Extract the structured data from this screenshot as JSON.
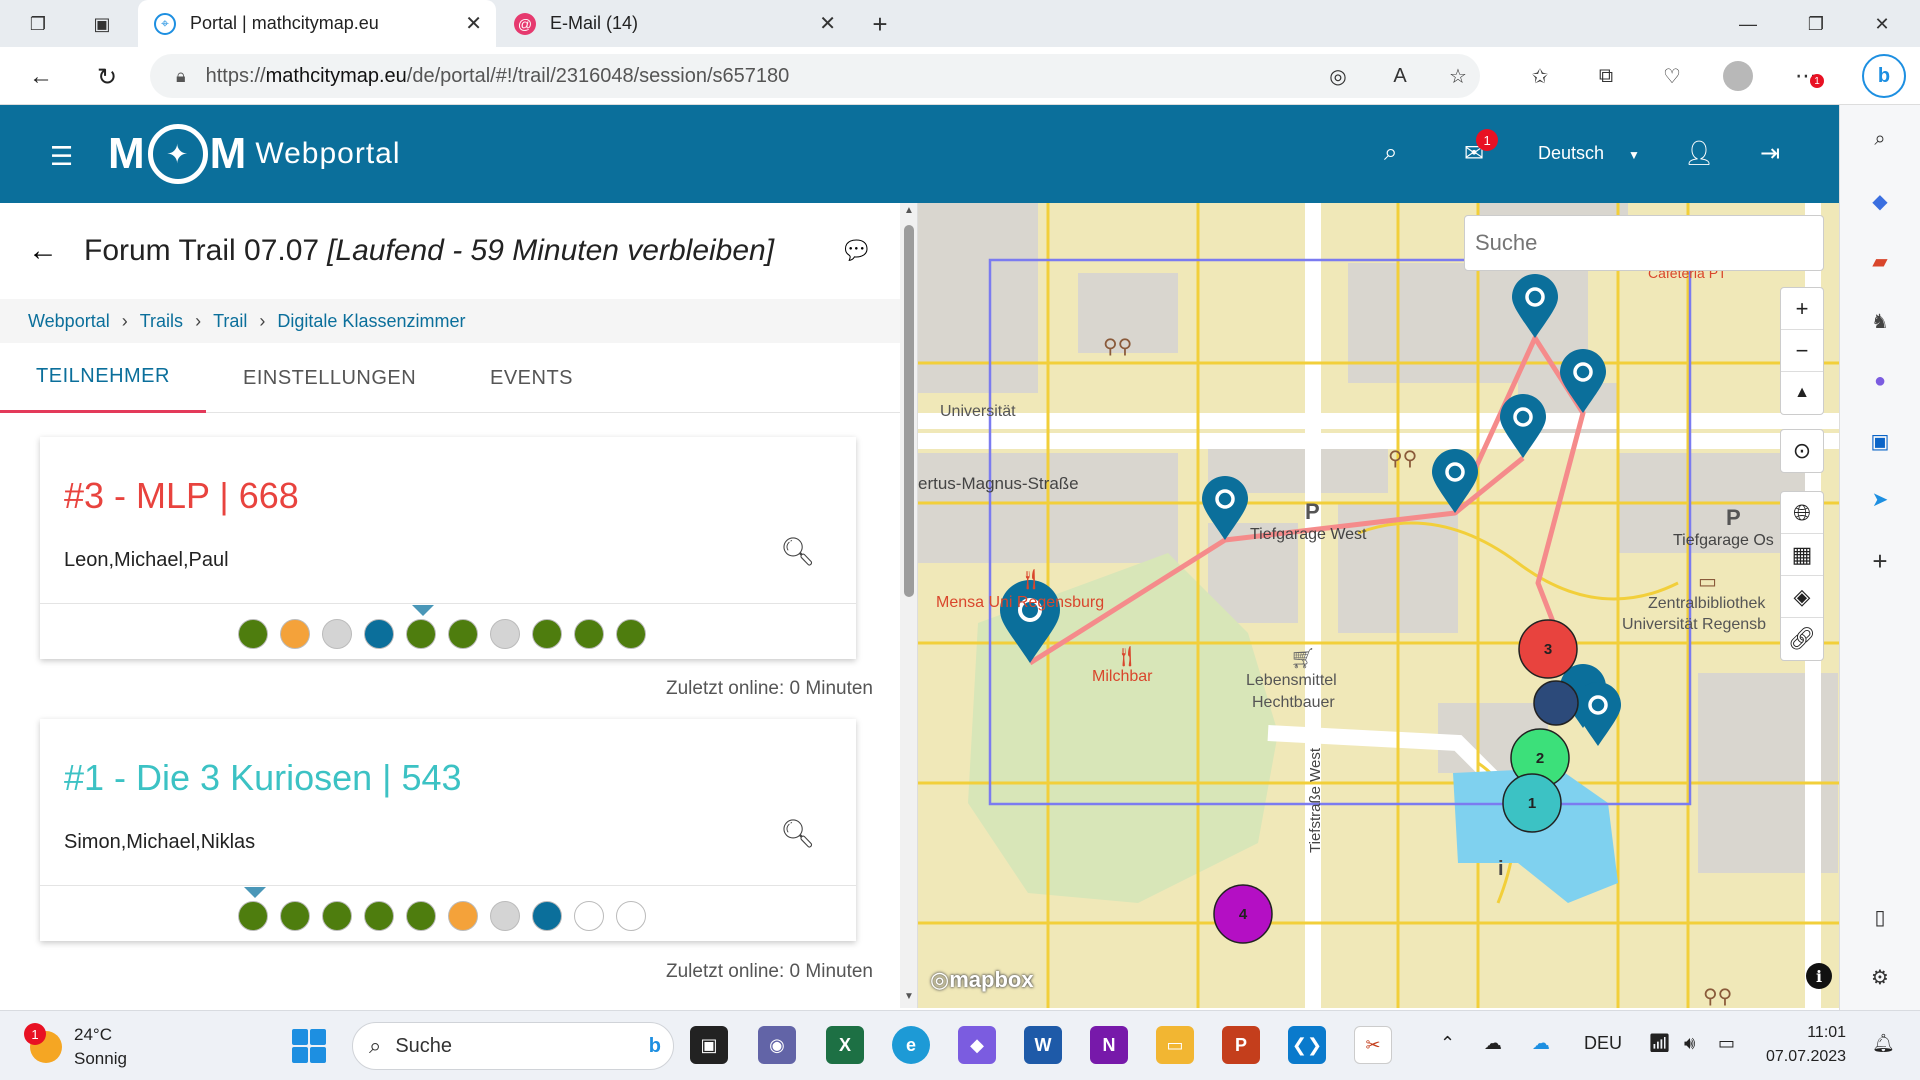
{
  "browser": {
    "tabs": [
      {
        "title": "Portal | mathcitymap.eu",
        "active": true
      },
      {
        "title": "E-Mail (14)",
        "active": false
      }
    ],
    "url_prefix": "https://",
    "url_host": "mathcitymap.eu",
    "url_path": "/de/portal/#!/trail/2316048/session/s657180",
    "notification_badge": "1"
  },
  "header": {
    "logo_text_m1": "M",
    "logo_text_m2": "M",
    "logo_suffix": "Webportal",
    "mail_badge": "1",
    "language": "Deutsch"
  },
  "trail": {
    "title": "Forum Trail 07.07",
    "status": "[Laufend - 59 Minuten verbleiben]"
  },
  "breadcrumb": [
    "Webportal",
    "Trails",
    "Trail",
    "Digitale Klassenzimmer"
  ],
  "tabs": [
    "TEILNEHMER",
    "EINSTELLUNGEN",
    "EVENTS"
  ],
  "teams": [
    {
      "name": "#3 - MLP | 668",
      "color": "#e8433e",
      "members": "Leon,Michael,Paul",
      "progress_dots": [
        "#4e7d0e",
        "#f4a23a",
        "#d4d4d4",
        "#0b6f9b",
        "#4e7d0e",
        "#4e7d0e",
        "#d4d4d4",
        "#4e7d0e",
        "#4e7d0e",
        "#4e7d0e"
      ],
      "pointer_index": 4,
      "last_online": "Zuletzt online: 0 Minuten"
    },
    {
      "name": "#1 - Die 3 Kuriosen | 543",
      "color": "#3cc2c4",
      "members": "Simon,Michael,Niklas",
      "progress_dots": [
        "#4e7d0e",
        "#4e7d0e",
        "#4e7d0e",
        "#4e7d0e",
        "#4e7d0e",
        "#f4a23a",
        "#d4d4d4",
        "#0b6f9b",
        "#ffffff",
        "#ffffff"
      ],
      "pointer_index": 0,
      "last_online": "Zuletzt online: 0 Minuten"
    }
  ],
  "map": {
    "search_placeholder": "Suche",
    "labels": {
      "universitaet": "Universität",
      "street": "ertus-Magnus-Straße",
      "tiefgarage_west": "Tiefgarage West",
      "tiefgarage_ost": "Tiefgarage Os",
      "mensa": "Mensa Uni Regensburg",
      "milchbar": "Milchbar",
      "lebensmittel": "Lebensmittel",
      "hechtbauer": "Hechtbauer",
      "zentralbibliothek": "Zentralbibliothek",
      "uni_regensb": "Universität Regensb",
      "tiefstrasse": "Tiefstraße West",
      "cafeteria": "Cafeteria PT",
      "parking": "P"
    },
    "team_markers": [
      {
        "label": "3",
        "color": "#e8433e"
      },
      {
        "label": "2",
        "color": "#3ce07a"
      },
      {
        "label": "1",
        "color": "#3cc2c4"
      },
      {
        "label": "4",
        "color": "#b40fc4"
      }
    ],
    "attribution": "mapbox"
  },
  "taskbar": {
    "weather_temp": "24°C",
    "weather_desc": "Sonnig",
    "weather_badge": "1",
    "search_label": "Suche",
    "language": "DEU",
    "time": "11:01",
    "date": "07.07.2023"
  },
  "colors": {
    "brand": "#0b6f9b",
    "accent_tab": "#e33a5a",
    "route": "#f58b8b",
    "boundary": "#7b7bf0"
  }
}
